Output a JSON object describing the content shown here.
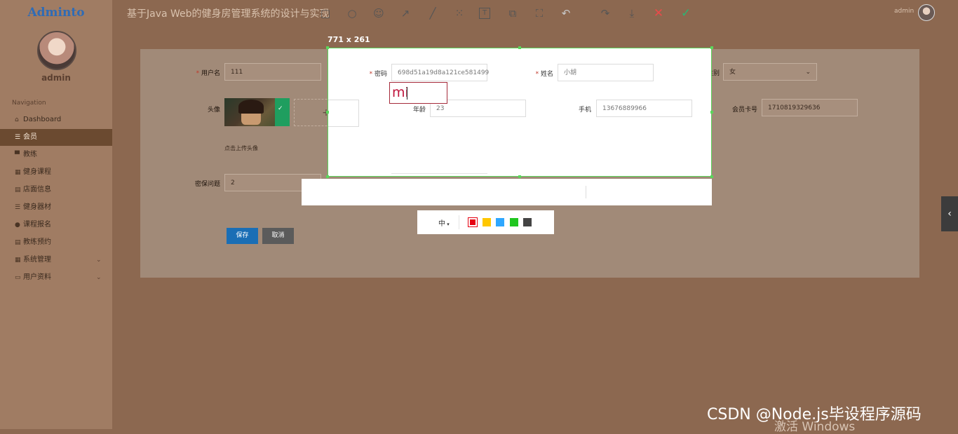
{
  "app": {
    "logo": "Adminto",
    "title": "基于Java Web的健身房管理系统的设计与实现",
    "header_user": "admin"
  },
  "sidebar": {
    "username": "admin",
    "heading": "Navigation",
    "items": [
      {
        "label": "Dashboard",
        "icon": "home-icon"
      },
      {
        "label": "会员",
        "icon": "list-icon",
        "active": true
      },
      {
        "label": "教练",
        "icon": "monitor-icon"
      },
      {
        "label": "健身课程",
        "icon": "grid-icon"
      },
      {
        "label": "店面信息",
        "icon": "document-icon"
      },
      {
        "label": "健身器材",
        "icon": "list-icon"
      },
      {
        "label": "课程报名",
        "icon": "user-icon"
      },
      {
        "label": "教练预约",
        "icon": "document-icon"
      },
      {
        "label": "系统管理",
        "icon": "grid-icon",
        "expandable": true
      },
      {
        "label": "用户资料",
        "icon": "card-icon",
        "expandable": true
      }
    ]
  },
  "form": {
    "username_label": "用户名",
    "username_value": "111",
    "password_label": "密码",
    "password_value": "698d51a19d8a121ce581499",
    "name_label": "姓名",
    "name_value": "小胡",
    "gender_label": "性别",
    "gender_value": "女",
    "avatar_label": "头像",
    "avatar_hint": "点击上传头像",
    "age_label": "年龄",
    "age_value": "23",
    "phone_label": "手机",
    "phone_value": "13676889966",
    "card_label": "会员卡号",
    "card_value": "1710819329636",
    "security_label": "密保问题",
    "security_value": "2",
    "save_label": "保存",
    "cancel_label": "取消"
  },
  "screenshot_tool": {
    "dimensions": "771 x 261",
    "text_input": "mi",
    "size_option": "中",
    "tools": [
      "rectangle-icon",
      "ellipse-icon",
      "emoji-icon",
      "arrow-icon",
      "line-icon",
      "mosaic-icon",
      "text-icon",
      "pin-icon",
      "ocr-icon",
      "undo-icon",
      "share-icon",
      "download-icon",
      "close-icon",
      "check-icon"
    ],
    "colors": [
      "#e60012",
      "#ffc700",
      "#2ea7ff",
      "#20c620",
      "#444444"
    ],
    "selected_color": "#e60012"
  },
  "watermarks": {
    "csdn": "CSDN @Node.js毕设程序源码",
    "windows": "激活 Windows"
  },
  "colors": {
    "accent": "#1a6eb5",
    "selection_border": "#5bd65b"
  }
}
